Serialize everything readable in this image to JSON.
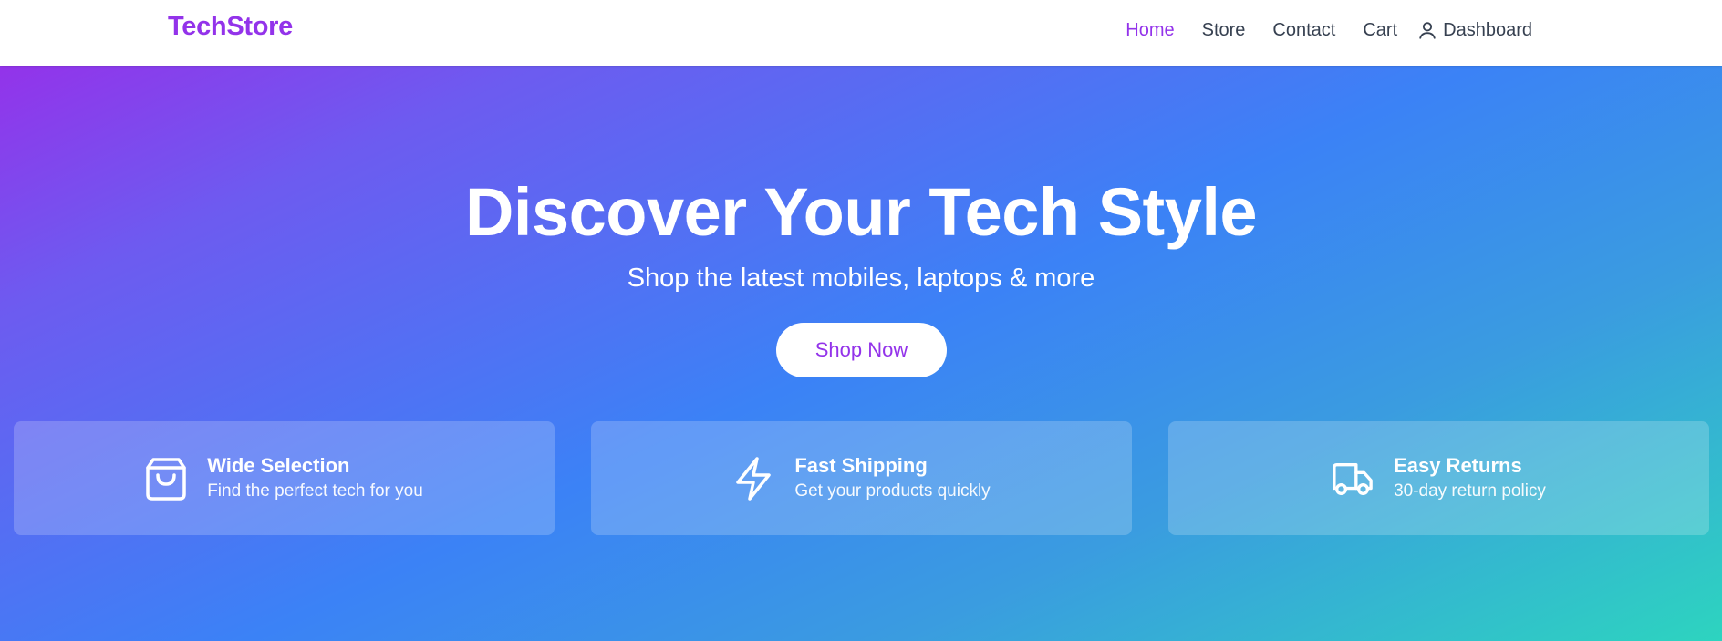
{
  "brand": "TechStore",
  "nav": {
    "home": "Home",
    "store": "Store",
    "contact": "Contact",
    "cart": "Cart",
    "dashboard": "Dashboard"
  },
  "hero": {
    "title": "Discover Your Tech Style",
    "subtitle": "Shop the latest mobiles, laptops & more",
    "cta": "Shop Now"
  },
  "features": [
    {
      "icon": "shopping-bag-icon",
      "title": "Wide Selection",
      "description": "Find the perfect tech for you"
    },
    {
      "icon": "lightning-bolt-icon",
      "title": "Fast Shipping",
      "description": "Get your products quickly"
    },
    {
      "icon": "truck-icon",
      "title": "Easy Returns",
      "description": "30-day return policy"
    }
  ],
  "colors": {
    "brand": "#9333ea",
    "gradient_start": "#9333ea",
    "gradient_mid": "#3b82f6",
    "gradient_end": "#2dd4bf"
  }
}
